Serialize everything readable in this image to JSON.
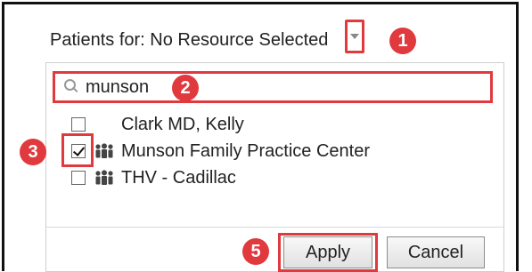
{
  "header": {
    "label": "Patients for: No Resource Selected"
  },
  "search": {
    "value": "munson"
  },
  "list": {
    "items": [
      {
        "label": "Clark MD, Kelly",
        "checked": false,
        "icon": null
      },
      {
        "label": "Munson Family Practice Center",
        "checked": true,
        "icon": "group-icon"
      },
      {
        "label": "THV - Cadillac",
        "checked": false,
        "icon": "group-icon"
      }
    ]
  },
  "buttons": {
    "apply": "Apply",
    "cancel": "Cancel"
  },
  "callouts": {
    "one": "1",
    "two": "2",
    "three": "3",
    "five": "5"
  },
  "colors": {
    "highlight": "#e0393e",
    "icon": "#444444"
  }
}
